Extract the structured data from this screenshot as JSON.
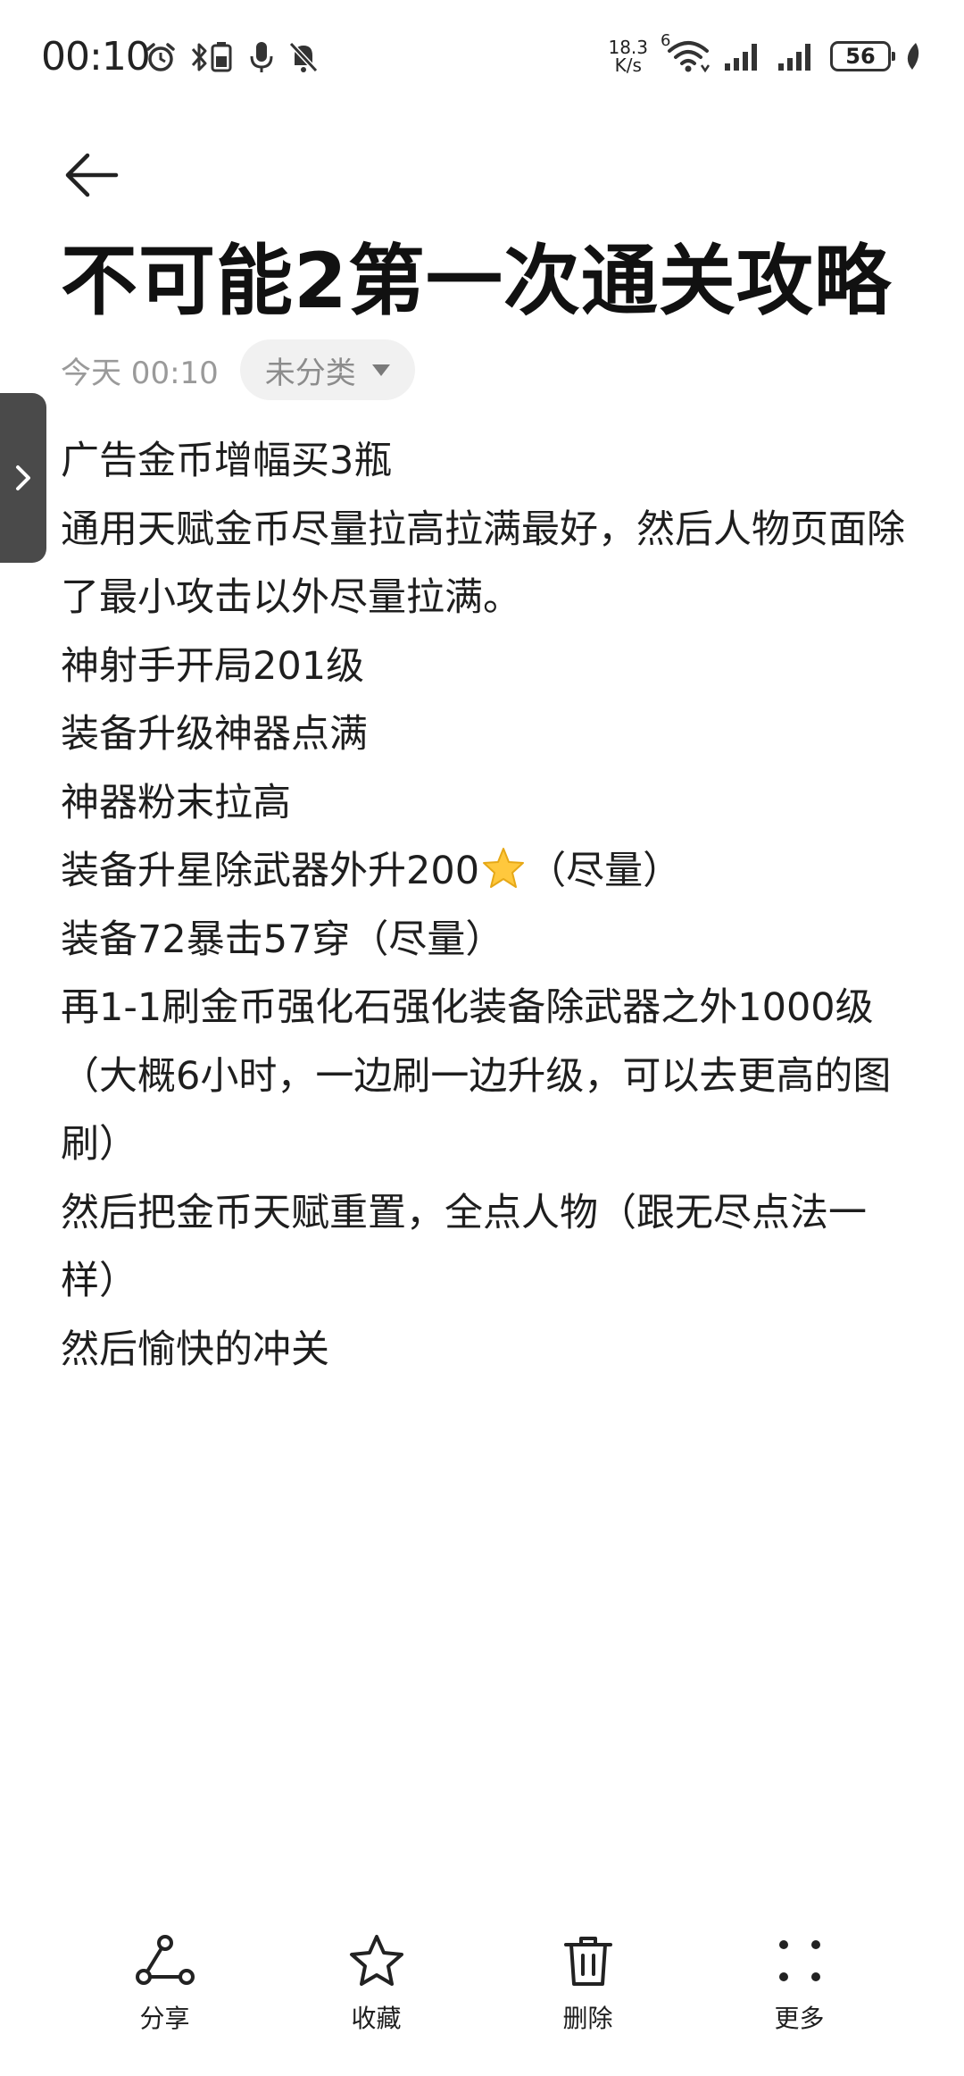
{
  "status_bar": {
    "time": "00:10",
    "net_speed_value": "18.3",
    "net_speed_unit": "K/s",
    "wifi_generation": "6",
    "battery_level": "56",
    "icons": [
      "alarm-icon",
      "bluetooth-battery-icon",
      "microphone-icon",
      "mute-bell-icon",
      "wifi-icon",
      "signal-icon",
      "signal-icon",
      "battery-icon",
      "leaf-icon"
    ]
  },
  "header": {
    "back_icon": "arrow-left-icon"
  },
  "note": {
    "title": "不可能2第一次通关攻略",
    "date": "今天 00:10",
    "category": "未分类",
    "lines": [
      "广告金币增幅买3瓶",
      "通用天赋金币尽量拉高拉满最好，然后人物页面除了最小攻击以外尽量拉满。",
      "神射手开局201级",
      "装备升级神器点满",
      "神器粉末拉高",
      "装备72暴击57穿（尽量）",
      "再1-1刷金币强化石强化装备除武器之外1000级 （大概6小时，一边刷一边升级，可以去更高的图刷）",
      "然后把金币天赋重置，全点人物（跟无尽点法一样）",
      "然后愉快的冲关"
    ],
    "star_line": {
      "before": "装备升星除武器外升200",
      "after": "（尽量）",
      "icon": "star-icon"
    }
  },
  "toolbar": {
    "items": [
      {
        "label": "分享",
        "icon": "share-icon"
      },
      {
        "label": "收藏",
        "icon": "star-outline-icon"
      },
      {
        "label": "删除",
        "icon": "trash-icon"
      },
      {
        "label": "更多",
        "icon": "more-dots-icon"
      }
    ]
  },
  "colors": {
    "background": "#ffffff",
    "text": "#1e1e1e",
    "meta_text": "#9a9a9a",
    "chip_background": "#f1f1f1",
    "side_handle": "#4a4a4a",
    "star_fill": "#ffc83d"
  }
}
